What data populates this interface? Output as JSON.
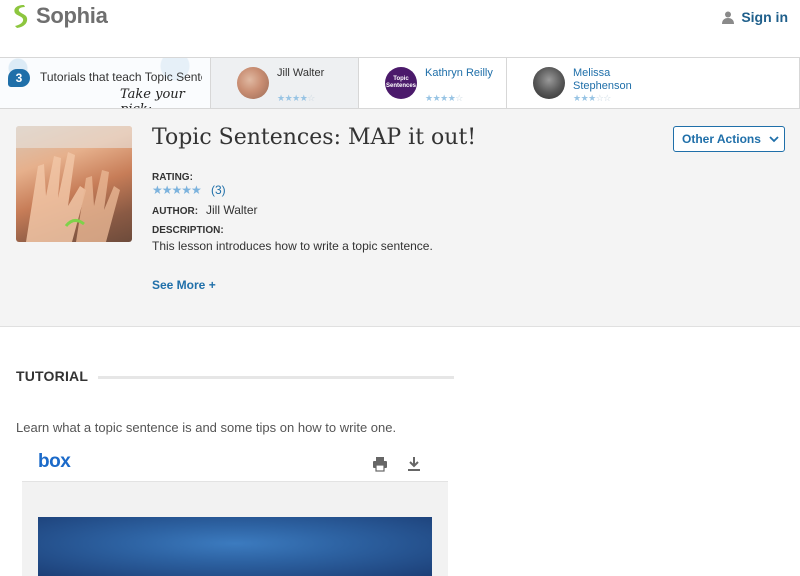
{
  "header": {
    "brand": "Sophia",
    "signin_label": "Sign in"
  },
  "strip": {
    "count": "3",
    "label": "Tutorials that teach Topic Sentences: MAP it out!",
    "pick": "Take your pick:",
    "cards": [
      {
        "name": "Jill Walter",
        "rating_stars": 4,
        "active": true
      },
      {
        "name": "Kathryn Reilly",
        "rating_stars": 4,
        "thumb_text_1": "Topic",
        "thumb_text_2": "Sentences"
      },
      {
        "name_line1": "Melissa",
        "name_line2": "Stephenson",
        "rating_stars": 3
      }
    ]
  },
  "lesson": {
    "title": "Topic Sentences: MAP it out!",
    "rating_label": "RATING:",
    "rating_stars": 5,
    "rating_count": "(3)",
    "author_label": "AUTHOR:",
    "author": "Jill Walter",
    "description_label": "DESCRIPTION:",
    "description": "This lesson introduces how to write a topic sentence.",
    "see_more": "See More +",
    "other_actions": "Other Actions"
  },
  "tutorial": {
    "heading": "TUTORIAL",
    "intro": "Learn what a topic sentence is and some tips on how to write one.",
    "embed_brand": "box"
  },
  "colors": {
    "accent": "#1f6fa9",
    "brand_green": "#8dc63f",
    "panel_bg": "#f4f4f4"
  }
}
